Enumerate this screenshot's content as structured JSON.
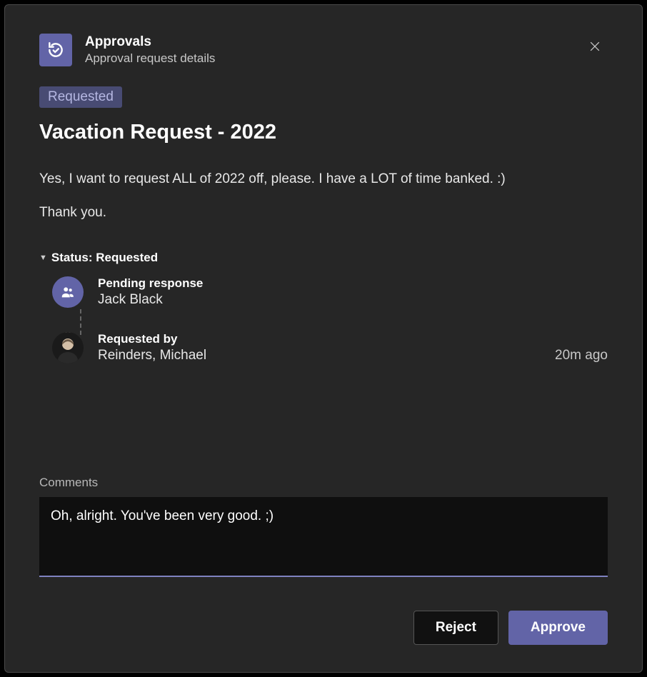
{
  "app": {
    "title": "Approvals",
    "subtitle": "Approval request details"
  },
  "status_badge": "Requested",
  "request": {
    "title": "Vacation Request - 2022",
    "description": "Yes, I want to request ALL of 2022 off, please. I have a LOT of time banked. :)",
    "thanks": "Thank you."
  },
  "status": {
    "header": "Status: Requested",
    "items": [
      {
        "label": "Pending response",
        "name": "Jack Black",
        "timestamp": ""
      },
      {
        "label": "Requested by",
        "name": "Reinders, Michael",
        "timestamp": "20m ago"
      }
    ]
  },
  "comments": {
    "label": "Comments",
    "value": "Oh, alright. You've been very good. ;)"
  },
  "actions": {
    "reject": "Reject",
    "approve": "Approve"
  }
}
